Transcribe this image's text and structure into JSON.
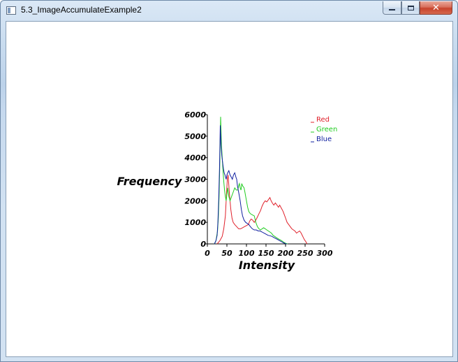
{
  "window": {
    "title": "5.3_ImageAccumulateExample2",
    "controls": {
      "minimize": "minimize-icon",
      "maximize": "maximize-icon",
      "close": "close-icon",
      "close_glyph": "✕"
    }
  },
  "chart_data": {
    "type": "line",
    "xlabel": "Intensity",
    "ylabel": "Frequency",
    "xlim": [
      0,
      300
    ],
    "ylim": [
      0,
      6000
    ],
    "x_ticks": [
      "0",
      "50",
      "100",
      "150",
      "200",
      "250",
      "300"
    ],
    "y_ticks": [
      "0",
      "1000",
      "2000",
      "3000",
      "4000",
      "5000",
      "6000"
    ],
    "legend_position": "top-right",
    "series": [
      {
        "name": "Red",
        "color": "#e0202a",
        "points": [
          [
            25,
            0
          ],
          [
            32,
            150
          ],
          [
            38,
            350
          ],
          [
            42,
            700
          ],
          [
            46,
            1300
          ],
          [
            49,
            2300
          ],
          [
            51,
            3000
          ],
          [
            53,
            3200
          ],
          [
            55,
            2700
          ],
          [
            57,
            2200
          ],
          [
            60,
            1600
          ],
          [
            63,
            1200
          ],
          [
            66,
            1000
          ],
          [
            70,
            900
          ],
          [
            75,
            800
          ],
          [
            80,
            700
          ],
          [
            85,
            700
          ],
          [
            90,
            750
          ],
          [
            95,
            800
          ],
          [
            100,
            850
          ],
          [
            105,
            900
          ],
          [
            108,
            1050
          ],
          [
            112,
            1150
          ],
          [
            116,
            1100
          ],
          [
            120,
            1000
          ],
          [
            124,
            1100
          ],
          [
            128,
            1250
          ],
          [
            132,
            1400
          ],
          [
            136,
            1550
          ],
          [
            140,
            1750
          ],
          [
            144,
            1900
          ],
          [
            148,
            2000
          ],
          [
            152,
            1950
          ],
          [
            156,
            2050
          ],
          [
            160,
            2150
          ],
          [
            163,
            2000
          ],
          [
            166,
            1900
          ],
          [
            170,
            1800
          ],
          [
            174,
            1900
          ],
          [
            178,
            1800
          ],
          [
            182,
            1700
          ],
          [
            185,
            1800
          ],
          [
            188,
            1700
          ],
          [
            191,
            1600
          ],
          [
            194,
            1500
          ],
          [
            197,
            1350
          ],
          [
            200,
            1200
          ],
          [
            204,
            1000
          ],
          [
            208,
            900
          ],
          [
            212,
            800
          ],
          [
            216,
            700
          ],
          [
            220,
            650
          ],
          [
            224,
            600
          ],
          [
            228,
            500
          ],
          [
            232,
            550
          ],
          [
            236,
            600
          ],
          [
            240,
            500
          ],
          [
            244,
            350
          ],
          [
            248,
            200
          ],
          [
            252,
            100
          ],
          [
            255,
            0
          ]
        ]
      },
      {
        "name": "Green",
        "color": "#20cc20",
        "points": [
          [
            18,
            0
          ],
          [
            22,
            150
          ],
          [
            26,
            600
          ],
          [
            28,
            1200
          ],
          [
            30,
            2200
          ],
          [
            32,
            3800
          ],
          [
            34,
            5900
          ],
          [
            36,
            4600
          ],
          [
            38,
            4000
          ],
          [
            40,
            3400
          ],
          [
            42,
            2900
          ],
          [
            44,
            2500
          ],
          [
            46,
            2200
          ],
          [
            48,
            2000
          ],
          [
            50,
            2300
          ],
          [
            52,
            2600
          ],
          [
            55,
            2200
          ],
          [
            58,
            2000
          ],
          [
            62,
            2200
          ],
          [
            66,
            2400
          ],
          [
            70,
            2600
          ],
          [
            74,
            2500
          ],
          [
            78,
            2500
          ],
          [
            80,
            2700
          ],
          [
            82,
            2800
          ],
          [
            84,
            2600
          ],
          [
            86,
            2500
          ],
          [
            88,
            2800
          ],
          [
            90,
            2700
          ],
          [
            94,
            2600
          ],
          [
            96,
            2400
          ],
          [
            98,
            2200
          ],
          [
            100,
            2000
          ],
          [
            103,
            1700
          ],
          [
            106,
            1500
          ],
          [
            110,
            1400
          ],
          [
            115,
            1350
          ],
          [
            120,
            1300
          ],
          [
            124,
            1000
          ],
          [
            128,
            800
          ],
          [
            132,
            700
          ],
          [
            136,
            650
          ],
          [
            140,
            700
          ],
          [
            144,
            750
          ],
          [
            148,
            700
          ],
          [
            152,
            650
          ],
          [
            156,
            600
          ],
          [
            160,
            550
          ],
          [
            164,
            500
          ],
          [
            168,
            400
          ],
          [
            172,
            350
          ],
          [
            176,
            300
          ],
          [
            180,
            250
          ],
          [
            185,
            200
          ],
          [
            190,
            150
          ],
          [
            195,
            80
          ],
          [
            200,
            30
          ],
          [
            205,
            0
          ]
        ]
      },
      {
        "name": "Blue",
        "color": "#1020a0",
        "points": [
          [
            18,
            0
          ],
          [
            22,
            150
          ],
          [
            25,
            400
          ],
          [
            27,
            1000
          ],
          [
            29,
            2000
          ],
          [
            31,
            3500
          ],
          [
            33,
            5500
          ],
          [
            35,
            4600
          ],
          [
            37,
            4100
          ],
          [
            39,
            3800
          ],
          [
            41,
            3500
          ],
          [
            43,
            3300
          ],
          [
            45,
            3200
          ],
          [
            48,
            3000
          ],
          [
            50,
            3200
          ],
          [
            52,
            3300
          ],
          [
            55,
            3400
          ],
          [
            58,
            3200
          ],
          [
            61,
            3100
          ],
          [
            64,
            3000
          ],
          [
            67,
            3200
          ],
          [
            70,
            3300
          ],
          [
            73,
            3100
          ],
          [
            75,
            3000
          ],
          [
            77,
            2700
          ],
          [
            79,
            2500
          ],
          [
            81,
            2300
          ],
          [
            84,
            2000
          ],
          [
            87,
            1600
          ],
          [
            90,
            1300
          ],
          [
            94,
            1100
          ],
          [
            98,
            1000
          ],
          [
            102,
            950
          ],
          [
            106,
            900
          ],
          [
            110,
            800
          ],
          [
            115,
            700
          ],
          [
            120,
            650
          ],
          [
            125,
            650
          ],
          [
            130,
            600
          ],
          [
            135,
            600
          ],
          [
            140,
            550
          ],
          [
            145,
            500
          ],
          [
            150,
            450
          ],
          [
            155,
            400
          ],
          [
            160,
            380
          ],
          [
            165,
            350
          ],
          [
            170,
            300
          ],
          [
            175,
            250
          ],
          [
            180,
            200
          ],
          [
            185,
            150
          ],
          [
            190,
            100
          ],
          [
            195,
            50
          ],
          [
            200,
            10
          ],
          [
            203,
            0
          ]
        ]
      }
    ]
  }
}
